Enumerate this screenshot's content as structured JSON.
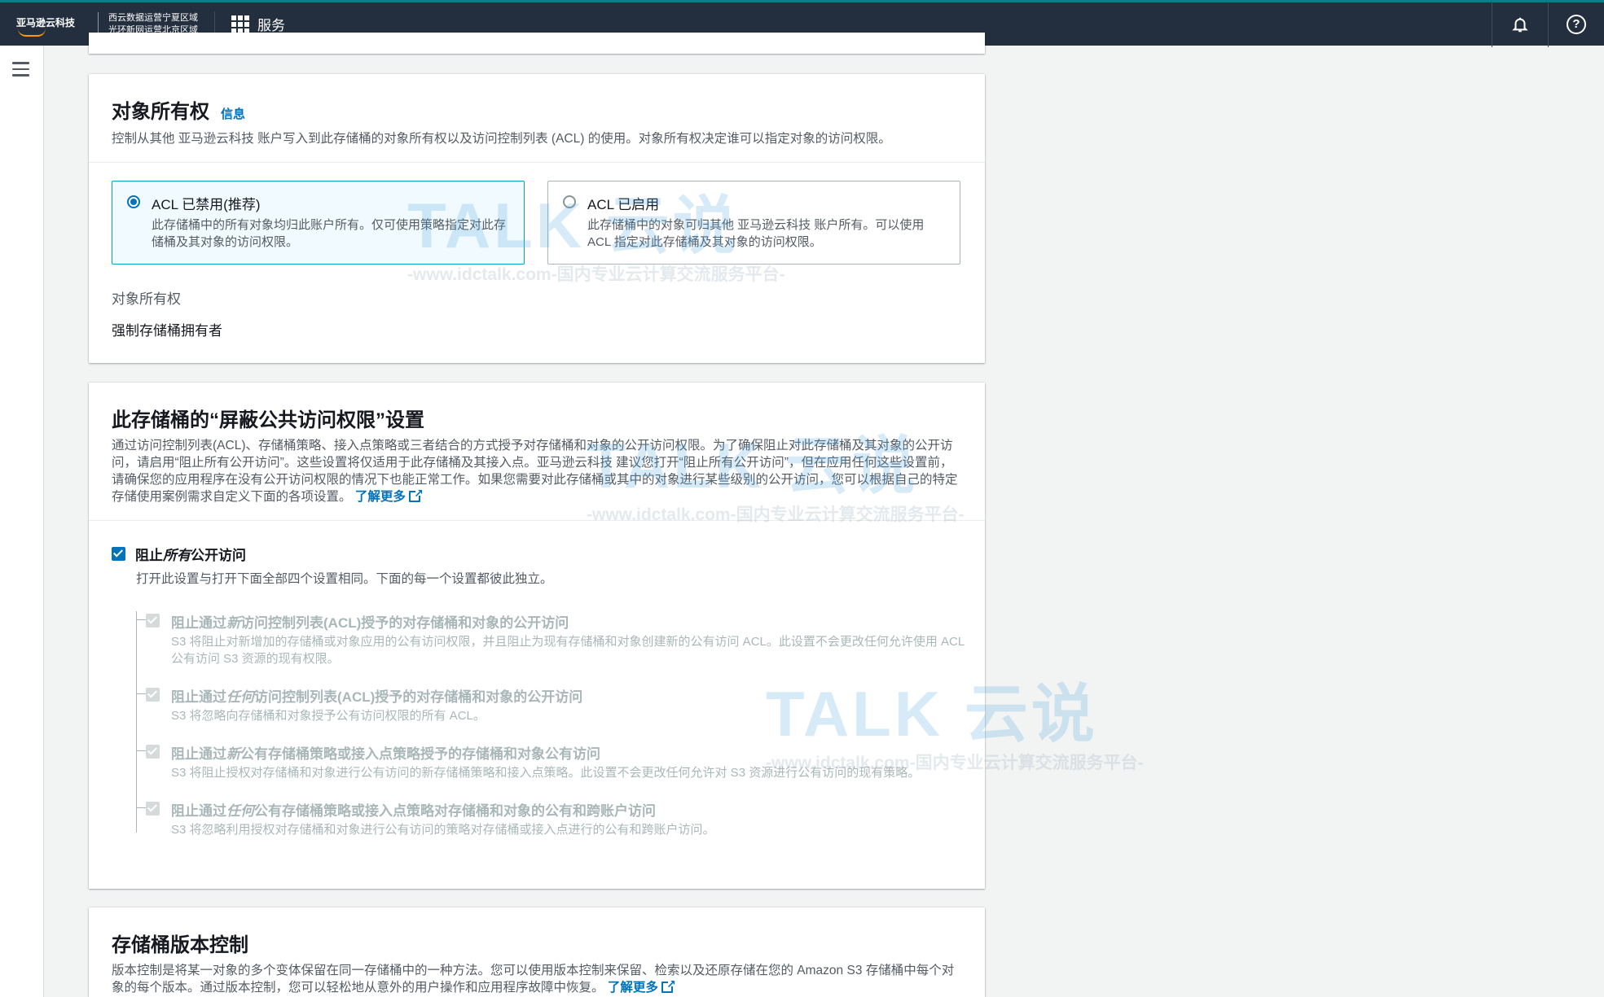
{
  "topnav": {
    "logo_text": "亚马逊云科技",
    "region_line1": "西云数据运营宁夏区域",
    "region_line2": "光环新网运营北京区域",
    "services_label": "服务"
  },
  "object_ownership": {
    "title": "对象所有权",
    "info_link": "信息",
    "description": "控制从其他 亚马逊云科技 账户写入到此存储桶的对象所有权以及访问控制列表 (ACL) 的使用。对象所有权决定谁可以指定对象的访问权限。",
    "options": [
      {
        "title": "ACL 已禁用(推荐)",
        "desc": "此存储桶中的所有对象均归此账户所有。仅可使用策略指定对此存储桶及其对象的访问权限。",
        "selected": true
      },
      {
        "title": "ACL 已启用",
        "desc": "此存储桶中的对象可归其他 亚马逊云科技 账户所有。可以使用 ACL 指定对此存储桶及其对象的访问权限。",
        "selected": false
      }
    ],
    "field_label": "对象所有权",
    "field_value": "强制存储桶拥有者"
  },
  "public_access": {
    "title": "此存储桶的“屏蔽公共访问权限”设置",
    "description": "通过访问控制列表(ACL)、存储桶策略、接入点策略或三者结合的方式授予对存储桶和对象的公开访问权限。为了确保阻止对此存储桶及其对象的公开访问，请启用“阻止所有公开访问”。这些设置将仅适用于此存储桶及其接入点。亚马逊云科技 建议您打开“阻止所有公开访问”，但在应用任何这些设置前，请确保您的应用程序在没有公开访问权限的情况下也能正常工作。如果您需要对此存储桶或其中的对象进行某些级别的公开访问，您可以根据自己的特定存储使用案例需求自定义下面的各项设置。",
    "learn_more": "了解更多",
    "block_all": {
      "pre": "阻止",
      "em": "所有",
      "post": "公开访问",
      "desc": "打开此设置与打开下面全部四个设置相同。下面的每一个设置都彼此独立。"
    },
    "sub_settings": [
      {
        "pre": "阻止通过",
        "em": "新",
        "post": "访问控制列表(ACL)授予的对存储桶和对象的公开访问",
        "desc": "S3 将阻止对新增加的存储桶或对象应用的公有访问权限，并且阻止为现有存储桶和对象创建新的公有访问 ACL。此设置不会更改任何允许使用 ACL 公有访问 S3 资源的现有权限。"
      },
      {
        "pre": "阻止通过",
        "em": "任何",
        "post": "访问控制列表(ACL)授予的对存储桶和对象的公开访问",
        "desc": "S3 将忽略向存储桶和对象授予公有访问权限的所有 ACL。"
      },
      {
        "pre": "阻止通过",
        "em": "新",
        "post": "公有存储桶策略或接入点策略授予的存储桶和对象公有访问",
        "desc": "S3 将阻止授权对存储桶和对象进行公有访问的新存储桶策略和接入点策略。此设置不会更改任何允许对 S3 资源进行公有访问的现有策略。"
      },
      {
        "pre": "阻止通过",
        "em": "任何",
        "post": "公有存储桶策略或接入点策略对存储桶和对象的公有和跨账户访问",
        "desc": "S3 将忽略利用授权对存储桶和对象进行公有访问的策略对存储桶或接入点进行的公有和跨账户访问。"
      }
    ]
  },
  "versioning": {
    "title": "存储桶版本控制",
    "description": "版本控制是将某一对象的多个变体保留在同一存储桶中的一种方法。您可以使用版本控制来保留、检索以及还原存储在您的 Amazon S3 存储桶中每个对象的每个版本。通过版本控制，您可以轻松地从意外的用户操作和应用程序故障中恢复。",
    "learn_more": "了解更多"
  },
  "watermark": {
    "brand": "TALK 云说",
    "url": "-www.idctalk.com-国内专业云计算交流服务平台-"
  }
}
